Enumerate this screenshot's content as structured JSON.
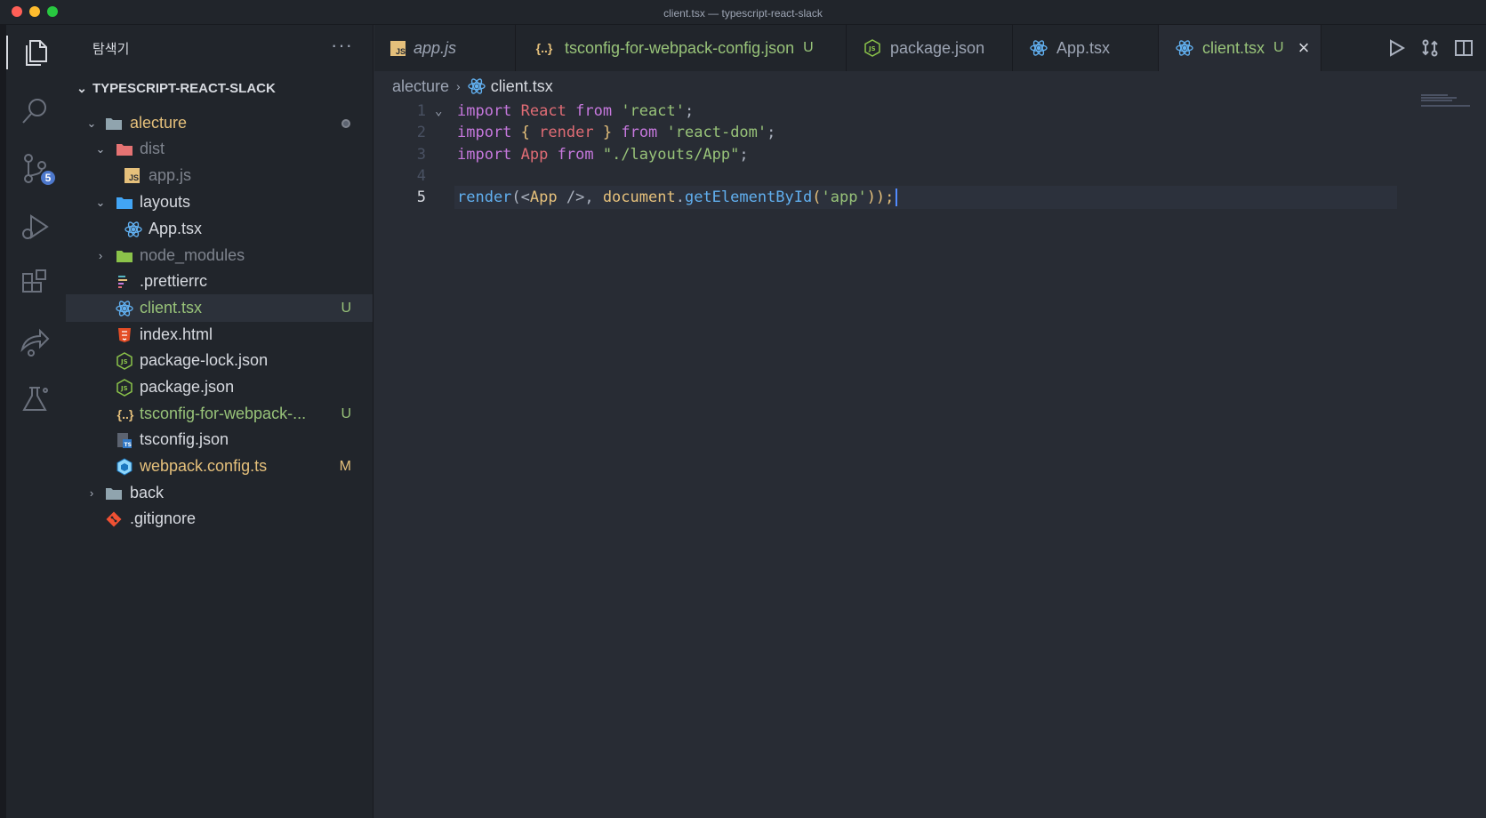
{
  "window": {
    "title": "client.tsx — typescript-react-slack"
  },
  "activity_bar": {
    "items": [
      {
        "name": "explorer",
        "icon": "files-icon",
        "active": true
      },
      {
        "name": "search",
        "icon": "search-icon"
      },
      {
        "name": "source-control",
        "icon": "source-control-icon",
        "badge": "5"
      },
      {
        "name": "run-debug",
        "icon": "run-debug-icon"
      },
      {
        "name": "extensions",
        "icon": "extensions-icon"
      },
      {
        "name": "live-share",
        "icon": "live-share-icon"
      },
      {
        "name": "testing",
        "icon": "flask-icon"
      }
    ]
  },
  "sidebar": {
    "title": "탐색기",
    "more": "···",
    "project": "TYPESCRIPT-REACT-SLACK",
    "items": [
      {
        "label": "alecture",
        "type": "folder"
      },
      {
        "label": "dist",
        "type": "folder"
      },
      {
        "label": "app.js",
        "type": "js"
      },
      {
        "label": "layouts",
        "type": "folder"
      },
      {
        "label": "App.tsx",
        "type": "react"
      },
      {
        "label": "node_modules",
        "type": "folder"
      },
      {
        "label": ".prettierrc",
        "type": "prettier"
      },
      {
        "label": "client.tsx",
        "type": "react",
        "status": "U"
      },
      {
        "label": "index.html",
        "type": "html"
      },
      {
        "label": "package-lock.json",
        "type": "node"
      },
      {
        "label": "package.json",
        "type": "node"
      },
      {
        "label": "tsconfig-for-webpack-...",
        "type": "json",
        "status": "U"
      },
      {
        "label": "tsconfig.json",
        "type": "ts"
      },
      {
        "label": "webpack.config.ts",
        "type": "webpack",
        "status": "M"
      },
      {
        "label": "back",
        "type": "folder"
      },
      {
        "label": ".gitignore",
        "type": "git"
      }
    ]
  },
  "tabs": [
    {
      "label": "app.js",
      "icon": "js-icon"
    },
    {
      "label": "tsconfig-for-webpack-config.json",
      "icon": "json-icon",
      "status": "U"
    },
    {
      "label": "package.json",
      "icon": "node-icon"
    },
    {
      "label": "App.tsx",
      "icon": "react-icon"
    },
    {
      "label": "client.tsx",
      "icon": "react-icon",
      "status": "U",
      "active": true
    }
  ],
  "breadcrumb": {
    "folder": "alecture",
    "file": "client.tsx"
  },
  "editor": {
    "line_numbers": [
      "1",
      "2",
      "3",
      "4",
      "5"
    ],
    "lines": {
      "l1": {
        "kw1": "import",
        "id": "React",
        "kw2": "from",
        "str": "'react'",
        "end": ";"
      },
      "l2": {
        "kw1": "import",
        "ob": "{",
        "id": "render",
        "cb": "}",
        "kw2": "from",
        "str": "'react-dom'",
        "end": ";"
      },
      "l3": {
        "kw1": "import",
        "id": "App",
        "kw2": "from",
        "str": "\"./layouts/App\"",
        "end": ";"
      },
      "l5": {
        "fn": "render",
        "p1": "(<",
        "cls": "App",
        "p2": " />, ",
        "obj": "document",
        "dot": ".",
        "method": "getElementById",
        "p3": "(",
        "str": "'app'",
        "p4": "));"
      }
    }
  },
  "colors": {
    "background": "#282c34",
    "sidebar": "#21252b",
    "untracked": "#98c379",
    "modified": "#e5c07b",
    "accent": "#61afef"
  }
}
